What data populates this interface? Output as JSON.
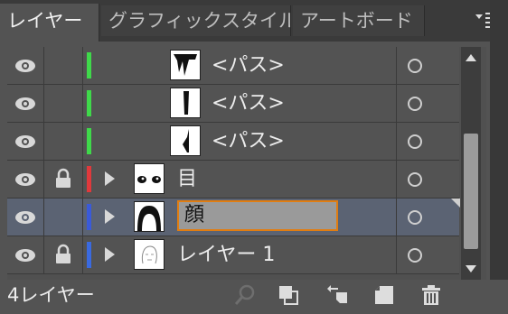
{
  "tabs": [
    {
      "label": "レイヤー",
      "active": true
    },
    {
      "label": "グラフィックスタイル",
      "active": false
    },
    {
      "label": "アートボード",
      "active": false
    }
  ],
  "layers": [
    {
      "name": "<パス>",
      "color": "#3fd94a",
      "indent": true,
      "locked": false,
      "expandable": false,
      "thumb": "path1-thumb"
    },
    {
      "name": "<パス>",
      "color": "#3fd94a",
      "indent": true,
      "locked": false,
      "expandable": false,
      "thumb": "path2-thumb"
    },
    {
      "name": "<パス>",
      "color": "#3fd94a",
      "indent": true,
      "locked": false,
      "expandable": false,
      "thumb": "path3-thumb"
    },
    {
      "name": "目",
      "color": "#e0393c",
      "indent": false,
      "locked": true,
      "expandable": true,
      "thumb": "eyes-thumb"
    },
    {
      "name": "顔",
      "color": "#3a5ad9",
      "indent": false,
      "locked": false,
      "expandable": true,
      "thumb": "face-thumb",
      "selected": true,
      "editing": true
    },
    {
      "name": "レイヤー 1",
      "color": "#3a6ae0",
      "indent": false,
      "locked": true,
      "expandable": true,
      "thumb": "sketch-thumb"
    }
  ],
  "footer": {
    "count": "4レイヤー"
  },
  "icons": {
    "eye": "eye-icon",
    "lock": "lock-icon",
    "expand": "disclosure-triangle-icon",
    "target": "target-circle-icon",
    "menu": "panel-menu-icon",
    "search": "locate-object-icon",
    "mask": "make-clipping-mask-icon",
    "sublayer": "create-sublayer-icon",
    "newlayer": "create-new-layer-icon",
    "delete": "trash-icon"
  }
}
